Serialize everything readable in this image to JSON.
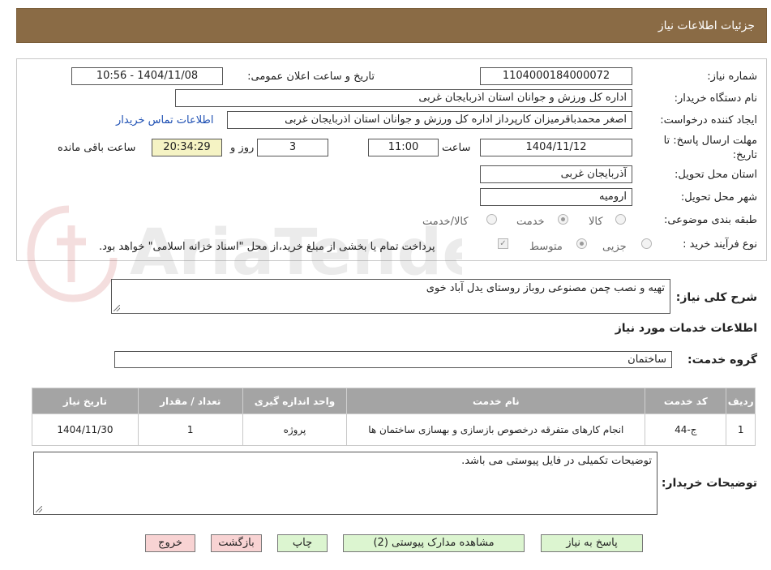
{
  "header": {
    "title": "جزئیات اطلاعات نیاز"
  },
  "fields": {
    "need_number_label": "شماره نیاز:",
    "need_number": "1104000184000072",
    "announce_label": "تاریخ و ساعت اعلان عمومی:",
    "announce_value": "1404/11/08 - 10:56",
    "buyer_org_label": "نام دستگاه خریدار:",
    "buyer_org": "اداره کل ورزش و جوانان استان اذربایجان غربی",
    "creator_label": "ایجاد کننده درخواست:",
    "creator": "اصغر محمدباقرمیزان کارپرداز اداره کل ورزش و جوانان استان اذربایجان غربی",
    "contact_link": "اطلاعات تماس خریدار",
    "deadline_label_1": "مهلت ارسال پاسخ: تا",
    "deadline_label_2": "تاریخ:",
    "deadline_date": "1404/11/12",
    "time_label": "ساعت",
    "deadline_time": "11:00",
    "days_value": "3",
    "days_label": "روز و",
    "remaining_time": "20:34:29",
    "remaining_label": "ساعت باقی مانده",
    "province_label": "استان محل تحویل:",
    "province": "آذربایجان غربی",
    "city_label": "شهر محل تحویل:",
    "city": "ارومیه",
    "category_label": "طبقه بندی موضوعی:",
    "category_options": [
      "کالا",
      "خدمت",
      "کالا/خدمت"
    ],
    "category_selected": "خدمت",
    "process_label": "نوع فرآیند خرید :",
    "process_options": [
      "جزیی",
      "متوسط"
    ],
    "process_selected": "متوسط",
    "payment_note": "پرداخت تمام یا بخشی از مبلغ خرید،از محل \"اسناد خزانه اسلامی\" خواهد بود.",
    "payment_checked": true
  },
  "description": {
    "label": "شرح کلی نیاز:",
    "text": "تهیه و نصب چمن مصنوعی روباز روستای یدل آباد خوی"
  },
  "services": {
    "section_title": "اطلاعات خدمات مورد نیاز",
    "group_label": "گروه خدمت:",
    "group_value": "ساختمان",
    "columns": [
      "ردیف",
      "کد خدمت",
      "نام خدمت",
      "واحد اندازه گیری",
      "تعداد / مقدار",
      "تاریخ نیاز"
    ],
    "rows": [
      {
        "row": "1",
        "code": "ج-44",
        "name": "انجام کارهای متفرقه درخصوص بازسازی و بهسازی ساختمان ها",
        "unit": "پروژه",
        "qty": "1",
        "date": "1404/11/30"
      }
    ]
  },
  "buyer_notes": {
    "label": "توضیحات خریدار:",
    "text": "توضیحات تکمیلی در فایل پیوستی می باشد."
  },
  "buttons": {
    "reply": "پاسخ به نیاز",
    "attachments": "مشاهده مدارک پیوستی (2)",
    "print": "چاپ",
    "back": "بازگشت",
    "exit": "خروج"
  },
  "colors": {
    "header_bg": "#8a6b45",
    "table_header_bg": "#a4a4a4",
    "button_green": "#dcf5d0",
    "button_pink": "#f8d3d3",
    "remaining_bg": "#f5f3c4"
  },
  "watermark_text": "AriaTender.neT"
}
